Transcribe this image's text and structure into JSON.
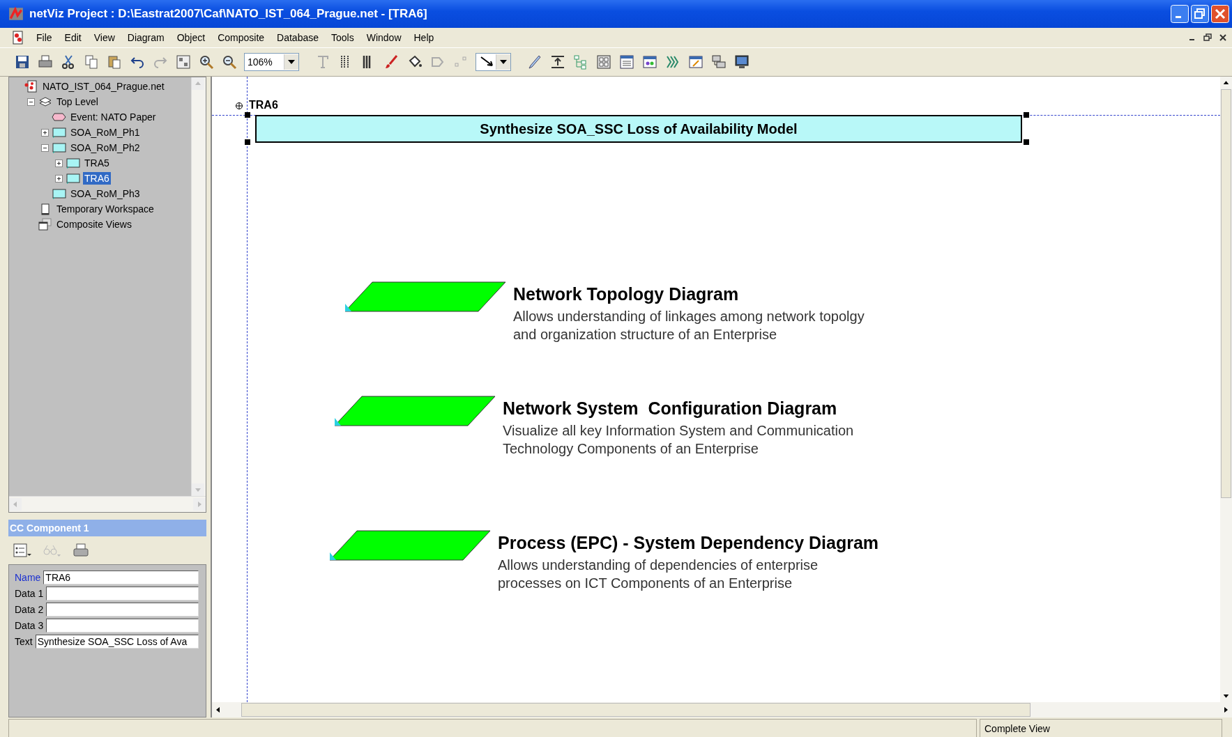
{
  "window": {
    "title": "netViz Project : D:\\Eastrat2007\\Caf\\NATO_IST_064_Prague.net - [TRA6]"
  },
  "menu": [
    "File",
    "Edit",
    "View",
    "Diagram",
    "Object",
    "Composite",
    "Database",
    "Tools",
    "Window",
    "Help"
  ],
  "toolbar": {
    "zoom": "106%"
  },
  "tree": {
    "label": "NATO_IST_064_Prague.net",
    "kind": "project",
    "selected": false,
    "children": [
      {
        "label": "Top Level",
        "kind": "layers",
        "expanded": true,
        "selected": false,
        "children": [
          {
            "label": "Event: NATO Paper",
            "kind": "event",
            "selected": false
          },
          {
            "label": "SOA_RoM_Ph1",
            "kind": "diagram",
            "expanded": false,
            "selected": false
          },
          {
            "label": "SOA_RoM_Ph2",
            "kind": "diagram",
            "expanded": true,
            "selected": false,
            "children": [
              {
                "label": "TRA5",
                "kind": "diagram",
                "expanded": false,
                "selected": false
              },
              {
                "label": "TRA6",
                "kind": "diagram",
                "expanded": false,
                "selected": true
              }
            ]
          },
          {
            "label": "SOA_RoM_Ph3",
            "kind": "diagram",
            "selected": false
          }
        ]
      },
      {
        "label": "Temporary Workspace",
        "kind": "workspace",
        "selected": false
      },
      {
        "label": "Composite Views",
        "kind": "composite",
        "selected": false
      }
    ]
  },
  "properties": {
    "title": "CC Component 1",
    "fields": [
      {
        "label": "Name",
        "value": "TRA6",
        "highlighted": true
      },
      {
        "label": "Data 1",
        "highlighted": false
      },
      {
        "label": "Data 2",
        "highlighted": false
      },
      {
        "label": "Data 3",
        "highlighted": false
      },
      {
        "label": "Text",
        "value": "Synthesize SOA_SSC Loss of Ava",
        "highlighted": false
      }
    ]
  },
  "canvas": {
    "label": "TRA6",
    "banner": "Synthesize SOA_SSC Loss of Availability Model",
    "items": [
      {
        "title": "Network Topology Diagram",
        "lines": [
          "Allows understanding of linkages among network topolgy",
          "and organization structure of an Enterprise"
        ]
      },
      {
        "title": "Network System  Configuration Diagram",
        "lines": [
          "Visualize all key Information System and Communication",
          "Technology Components of an Enterprise"
        ]
      },
      {
        "title": "Process (EPC) - System Dependency Diagram",
        "lines": [
          "Allows understanding of dependencies of enterprise",
          "processes on ICT Components of an Enterprise"
        ]
      }
    ]
  },
  "status_bar": {
    "view": "Complete View"
  }
}
